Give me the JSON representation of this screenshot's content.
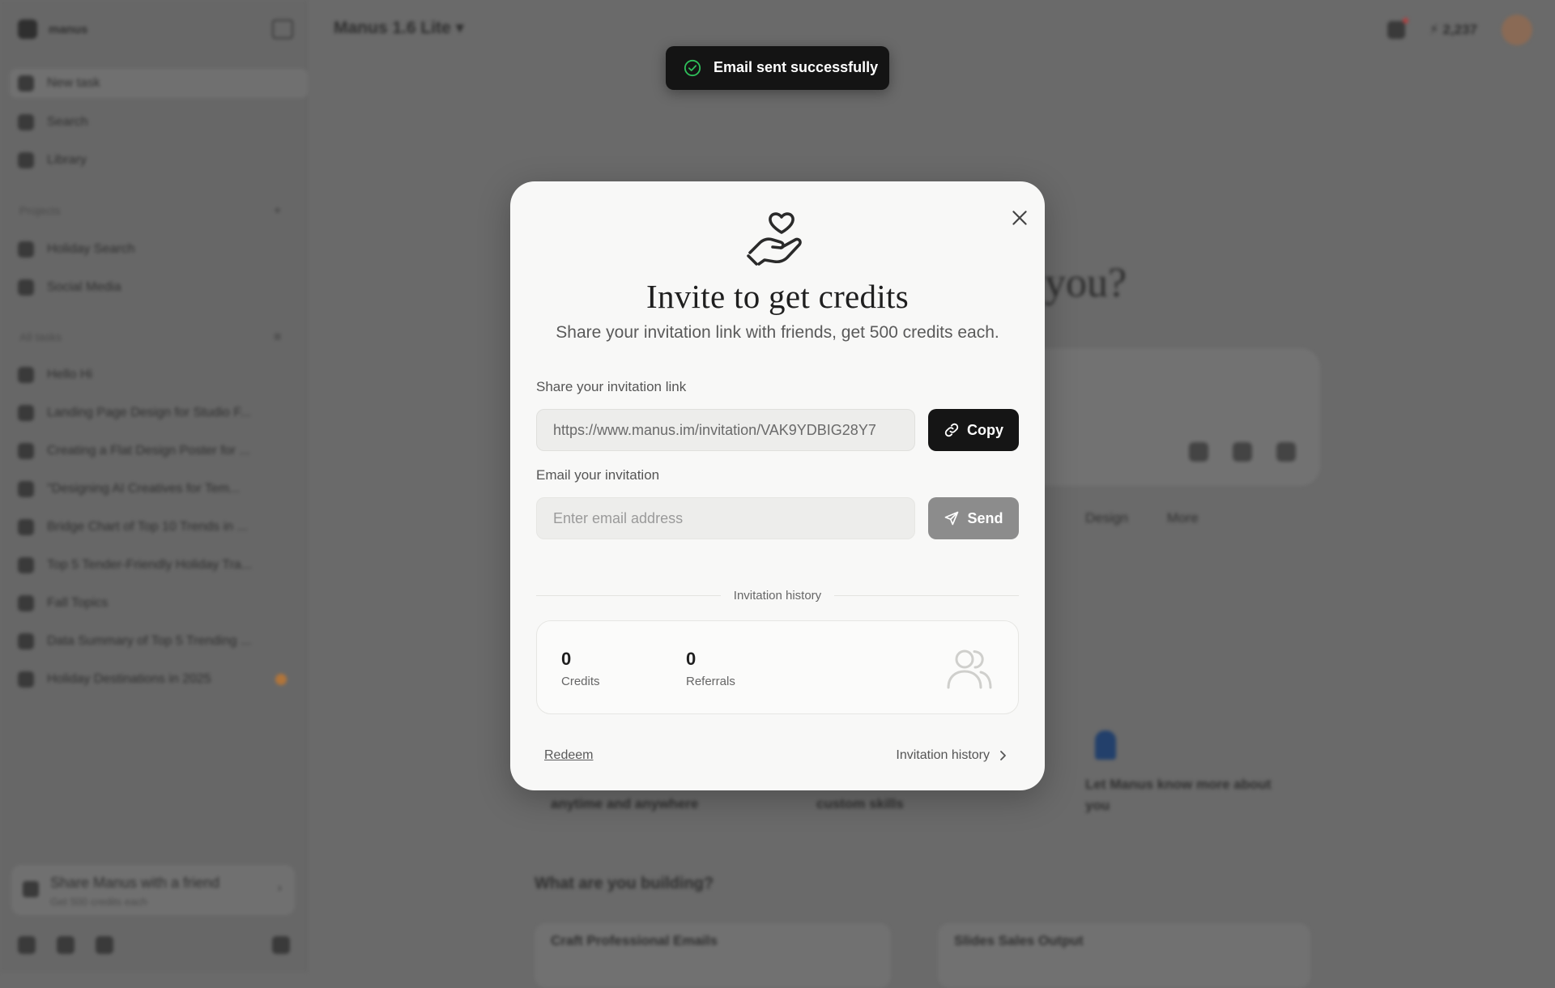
{
  "background": {
    "sidebar": {
      "brand": "manus",
      "nav": [
        "New task",
        "Search",
        "Library"
      ],
      "projects_label": "Projects",
      "projects": [
        "Holiday Search",
        "Social Media"
      ],
      "tasks_label": "All tasks",
      "tasks": [
        "Hello Hi",
        "Landing Page Design for Studio F...",
        "Creating a Flat Design Poster for ...",
        "\"Designing AI Creatives for Tem...",
        "Bridge Chart of Top 10 Trends in ...",
        "Top 5 Tender-Friendly Holiday Tra...",
        "Fall Topics",
        "Data Summary of Top 5 Trending ...",
        "Holiday Destinations in 2025"
      ],
      "share_title": "Share Manus with a friend",
      "share_sub": "Get 500 credits each"
    },
    "topbar": {
      "title": "Manus 1.6 Lite",
      "credits": "2,237"
    },
    "hero_text": "you?",
    "chips": [
      "Design",
      "More"
    ],
    "cards": [
      "anytime and anywhere",
      "custom skills",
      "Let Manus know more about you"
    ],
    "section_title": "What are you building?",
    "ghost_cards": [
      "Craft Professional Emails",
      "Slides Sales Output"
    ]
  },
  "toast": {
    "text": "Email sent successfully",
    "icon": "check-circle-icon",
    "color": "#2fbf5a"
  },
  "modal": {
    "icon": "heart-in-hand-icon",
    "title": "Invite to get credits",
    "subtitle": "Share your invitation link with friends, get 500 credits each.",
    "link_label": "Share your invitation link",
    "link_value": "https://www.manus.im/invitation/VAK9YDBIG28Y7",
    "copy_label": "Copy",
    "email_label": "Email your invitation",
    "email_placeholder": "Enter email address",
    "send_label": "Send",
    "history_divider": "Invitation history",
    "stats": [
      {
        "value": "0",
        "label": "Credits"
      },
      {
        "value": "0",
        "label": "Referrals"
      }
    ],
    "redeem_label": "Redeem",
    "history_link_label": "Invitation history"
  }
}
